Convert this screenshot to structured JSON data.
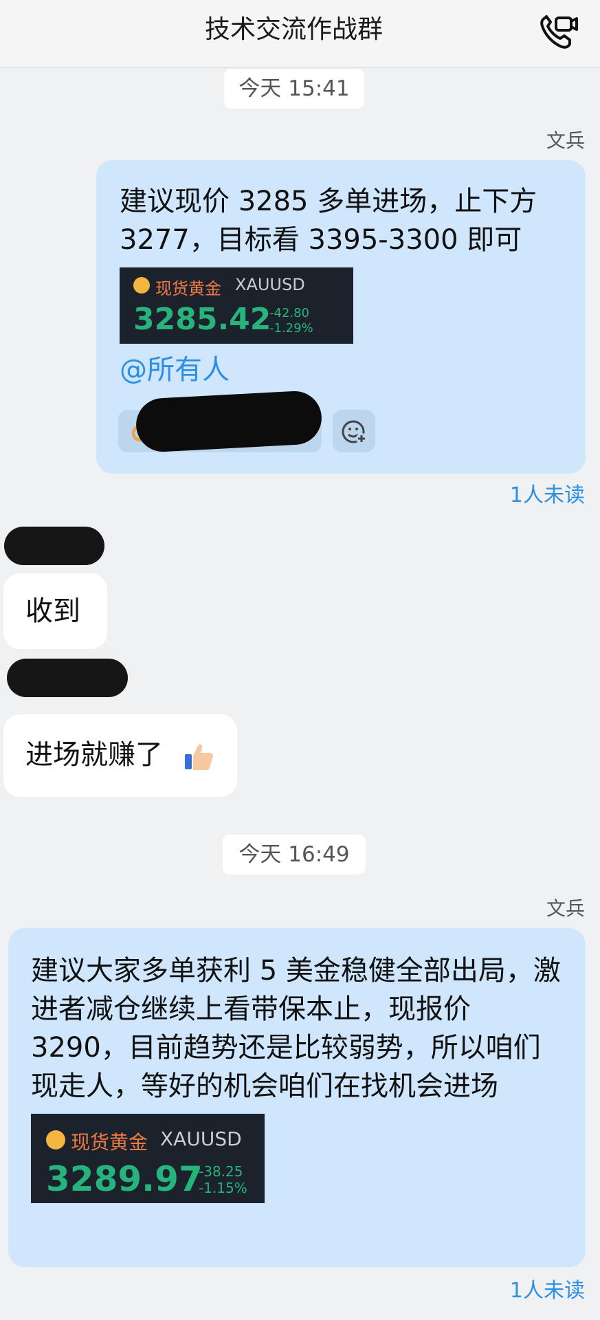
{
  "header": {
    "title": "技术交流作战群",
    "call_icon": "video-call-icon"
  },
  "messages": [
    {
      "time": "今天 15:41",
      "sender": "文兵",
      "text": "建议现价 3285 多单进场，止下方 3277，目标看 3395-3300 即可",
      "quote": {
        "name": "现货黄金",
        "symbol": "XAUUSD",
        "price": "3285.42",
        "change": "-42.80",
        "change_pct": "-1.29%"
      },
      "mention": "@所有人",
      "reaction_icon": "ok-hand-icon",
      "add_reaction_icon": "add-emoji-icon",
      "read_status": "1人未读"
    },
    {
      "text": "收到"
    },
    {
      "text": "进场就赚了",
      "emoji": "thumbs-up-icon"
    },
    {
      "time": "今天 16:49",
      "sender": "文兵",
      "text": "建议大家多单获利 5 美金稳健全部出局，激进者减仓继续上看带保本止，现报价 3290，目前趋势还是比较弱势，所以咱们现走人，等好的机会咱们在找机会进场",
      "quote": {
        "name": "现货黄金",
        "symbol": "XAUUSD",
        "price": "3289.97",
        "change": "-38.25",
        "change_pct": "-1.15%"
      },
      "read_status": "1人未读"
    }
  ],
  "colors": {
    "outgoing_bubble": "#cfe6fc",
    "accent": "#2b8fe3",
    "price_green": "#26b37c",
    "gold_label": "#f07a43"
  }
}
